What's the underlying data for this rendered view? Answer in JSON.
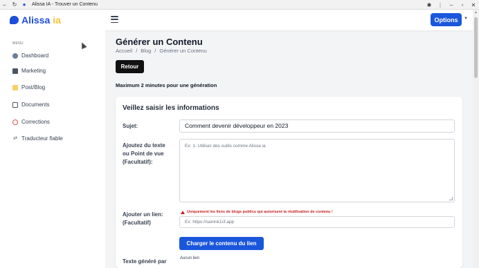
{
  "window": {
    "title": "Alissa IA - Trouver un Contenu"
  },
  "header": {
    "brand": "Alissa",
    "brand_suffix": "ia",
    "options_label": "Options",
    "brand_color": "#1d4ed8",
    "accent_color": "#f4c430",
    "primary_button_color": "#1a56db"
  },
  "sidebar": {
    "menu_label": "MENU",
    "items": [
      {
        "label": "Dashboard",
        "icon": "dashboard-icon"
      },
      {
        "label": "Marketing",
        "icon": "briefcase-icon"
      },
      {
        "label": "Post/Blog",
        "icon": "folder-icon"
      },
      {
        "label": "Documents",
        "icon": "document-icon"
      },
      {
        "label": "Corrections",
        "icon": "circle-x-icon"
      },
      {
        "label": "Traducteur fiable",
        "icon": "arrows-swap-icon"
      }
    ]
  },
  "main": {
    "title": "Générer un Contenu",
    "breadcrumb": [
      "Accueil",
      "Blog",
      "Générer un Contenu"
    ],
    "back_label": "Retour",
    "notice": "Maximum 2 minutes pour une génération"
  },
  "form": {
    "title": "Veillez saisir les informations",
    "subject_label": "Sujet:",
    "subject_value": "Comment devenir développeur en 2023",
    "angle_label": [
      "Ajoutez du texte",
      "ou Point de vue",
      "(Facultatif):"
    ],
    "angle_placeholder": "Ex: 1- Utiliser des outils comme Alissa ia",
    "link_label": [
      "Ajouter un lien:",
      "(Facultatif)"
    ],
    "link_warning": "Uniquement les liens de blogs publics qui autorisent la réutilisation de contenu !",
    "link_placeholder": "Ex: https://samnk1cf.app",
    "load_button": "Charger le contenu du lien",
    "generated_label": "Texte généré par",
    "no_link_text": "Aucun lien",
    "warning_color": "#c81e1e"
  }
}
